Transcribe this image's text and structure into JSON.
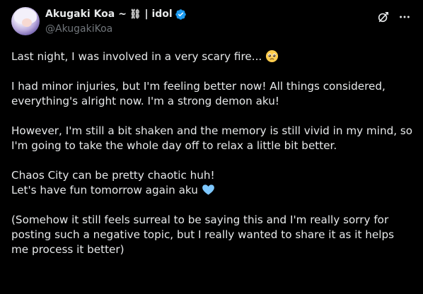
{
  "author": {
    "display_name": "Akugaki Koa",
    "name_suffix": "~",
    "chain_glyph": "⛓",
    "separator": "| idol",
    "handle": "@AkugakiKoa",
    "verified_color": "#1d9bf0"
  },
  "header_icons": {
    "grok": "grok-icon",
    "more": "more-options-icon"
  },
  "tweet": {
    "p1": "Last night, I was involved in a very scary fire...",
    "p1_emoji": "pleading-face-emoji",
    "p2": "I had minor injuries, but I'm feeling better now! All things considered, everything's alright now. I'm a strong demon aku!",
    "p3": "However, I'm still a bit shaken and the memory is still vivid in my mind, so I'm going to take the whole day off to relax a little bit better.",
    "p4_line1": "Chaos City can be pretty chaotic huh!",
    "p4_line2": "Let's have fun tomorrow again aku",
    "p4_emoji": "light-blue-heart-emoji",
    "p5": "(Somehow it still feels surreal to be saying this and I'm really sorry for posting such a negative topic, but I really wanted to share it as it helps me process it better)"
  },
  "colors": {
    "background": "#000000",
    "text": "#e7e9ea",
    "secondary_text": "#71767b",
    "heart": "#7ec8ff"
  }
}
